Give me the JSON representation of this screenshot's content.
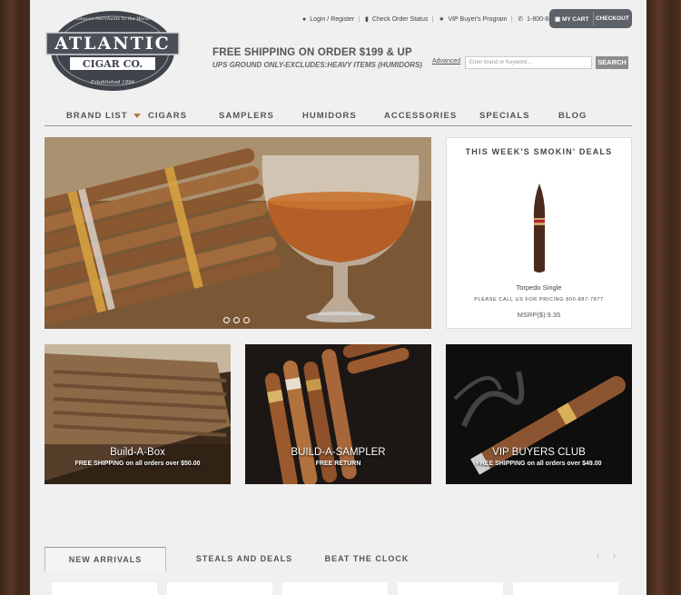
{
  "logo": {
    "main": "ATLANTIC",
    "sub": "CIGAR CO.",
    "arc_top": "Tobacco Merchants to the World",
    "arc_bottom": "Established 1994"
  },
  "toplinks": {
    "login": "Login / Register",
    "order": "Check Order Status",
    "vip": "VIP Buyer's Program",
    "phone": "1-800-887-7877"
  },
  "cart": {
    "my_cart": "MY CART",
    "checkout": "CHECKOUT"
  },
  "shipping": {
    "headline": "FREE SHIPPING ON ORDER $199 & UP",
    "note": "UPS GROUND ONLY-EXCLUDES:HEAVY ITEMS (HUMIDORS)"
  },
  "search": {
    "advanced": "Advanced",
    "placeholder": "Enter brand or Keyword...",
    "button": "SEARCH"
  },
  "nav": [
    "BRAND LIST",
    "CIGARS",
    "SAMPLERS",
    "HUMIDORS",
    "ACCESSORIES",
    "SPECIALS",
    "BLOG"
  ],
  "deals": {
    "title": "THIS WEEK'S SMOKIN' DEALS",
    "product": "Torpedo Single",
    "call": "PLEASE CALL US FOR PRICING 800-887-7877",
    "msrp": "MSRP($):9.35"
  },
  "tiles": [
    {
      "title": "Build-A-Box",
      "subtitle": "FREE SHIPPING on all orders over $50.00"
    },
    {
      "title": "BUILD-A-SAMPLER",
      "subtitle": "FREE RETURN"
    },
    {
      "title": "VIP BUYERS CLUB",
      "subtitle": "FREE SHIPPING on all orders over $49.00"
    }
  ],
  "tabs": [
    "NEW ARRIVALS",
    "STEALS AND DEALS",
    "BEAT THE CLOCK"
  ],
  "arrows": {
    "prev": "‹",
    "next": "›"
  },
  "colors": {
    "accent": "#b07a3a",
    "nav_text": "#555555",
    "button": "#8d8d8d",
    "cart": "#5d6168"
  }
}
